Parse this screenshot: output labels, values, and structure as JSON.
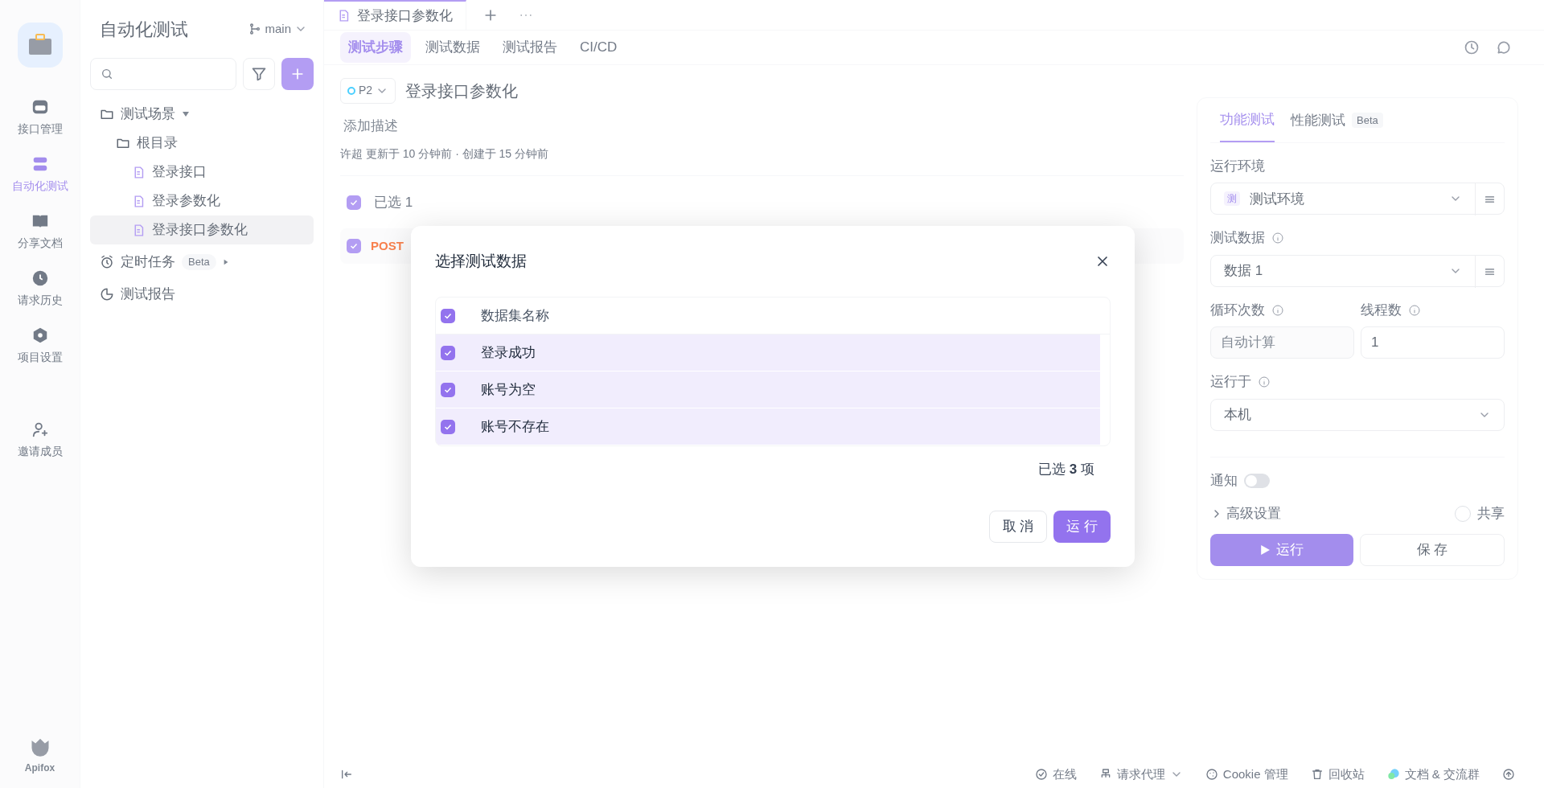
{
  "nav": [
    {
      "label": "接口管理",
      "selected": false
    },
    {
      "label": "自动化测试",
      "selected": true
    },
    {
      "label": "分享文档",
      "selected": false
    },
    {
      "label": "请求历史",
      "selected": false
    },
    {
      "label": "项目设置",
      "selected": false
    },
    {
      "label": "邀请成员",
      "selected": false
    }
  ],
  "brand": "Apifox",
  "tree_panel": {
    "title": "自动化测试",
    "branch": "main",
    "sections": [
      {
        "label": "测试场景",
        "kind": "scenes",
        "expanded": true,
        "children": [
          {
            "label": "根目录",
            "kind": "folder",
            "children": [
              {
                "label": "登录接口",
                "kind": "case",
                "selected": false
              },
              {
                "label": "登录参数化",
                "kind": "case",
                "selected": false
              },
              {
                "label": "登录接口参数化",
                "kind": "case",
                "selected": true
              }
            ]
          }
        ]
      },
      {
        "label": "定时任务",
        "kind": "timer",
        "badge": "Beta"
      },
      {
        "label": "测试报告",
        "kind": "report"
      }
    ]
  },
  "file_tab": {
    "label": "登录接口参数化"
  },
  "sub_tabs": [
    {
      "label": "测试步骤",
      "selected": true
    },
    {
      "label": "测试数据",
      "selected": false
    },
    {
      "label": "测试报告",
      "selected": false
    },
    {
      "label": "CI/CD",
      "selected": false
    }
  ],
  "scenario": {
    "priority": "P2",
    "title": "登录接口参数化",
    "description_placeholder": "添加描述",
    "meta": "许超 更新于 10 分钟前 · 创建于 15 分钟前",
    "selection_checked": true,
    "selection": "已选 1",
    "step": {
      "method": "POST",
      "checked": true
    }
  },
  "run_panel": {
    "tabs": [
      {
        "label": "功能测试",
        "selected": true
      },
      {
        "label": "性能测试",
        "selected": false,
        "badge": "Beta"
      }
    ],
    "environment_label": "运行环境",
    "environment_tag": "测",
    "environment": "测试环境",
    "data_label": "测试数据",
    "data": "数据 1",
    "loops_label": "循环次数",
    "loops_placeholder": "自动计算",
    "threads_label": "线程数",
    "threads": "1",
    "run_on_label": "运行于",
    "run_on": "本机",
    "notify_label": "通知",
    "notify_on": false,
    "advanced": "高级设置",
    "share_label": "共享",
    "share_checked": false,
    "run_button": "运行",
    "save_button": "保 存"
  },
  "status_bar": [
    {
      "label": "在线",
      "caret": false
    },
    {
      "label": "请求代理",
      "caret": true
    },
    {
      "label": "Cookie 管理",
      "caret": false
    },
    {
      "label": "回收站",
      "caret": false
    },
    {
      "label": "文档 & 交流群",
      "caret": false
    }
  ],
  "dialog": {
    "title": "选择测试数据",
    "column": "数据集名称",
    "header_checked": true,
    "rows": [
      {
        "name": "登录成功",
        "checked": true
      },
      {
        "name": "账号为空",
        "checked": true
      },
      {
        "name": "账号不存在",
        "checked": true
      }
    ],
    "summary": "已选 **3** 项",
    "cancel": "取 消",
    "run": "运 行"
  }
}
